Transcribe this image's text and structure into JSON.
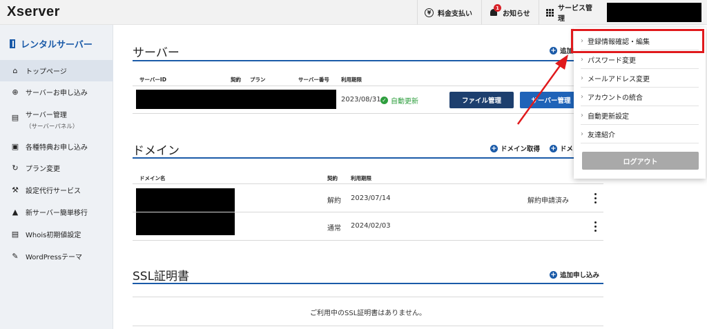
{
  "header": {
    "logo": "Xserver",
    "nav": [
      {
        "label": "料金支払い",
        "icon": "yen-icon"
      },
      {
        "label": "お知らせ",
        "icon": "bell-icon",
        "badge": "1"
      },
      {
        "label": "サービス管理",
        "icon": "grid-icon"
      }
    ]
  },
  "sidebar": {
    "title": "レンタルサーバー",
    "items": [
      {
        "label": "トップページ",
        "icon": "home-icon"
      },
      {
        "label": "サーバーお申し込み",
        "icon": "plus-circle-icon"
      },
      {
        "label": "サーバー管理",
        "sub": "（サーバーパネル）",
        "icon": "server-panel-icon"
      },
      {
        "label": "各種特典お申し込み",
        "icon": "gift-icon"
      },
      {
        "label": "プラン変更",
        "icon": "refresh-icon"
      },
      {
        "label": "設定代行サービス",
        "icon": "wrench-icon"
      },
      {
        "label": "新サーバー簡単移行",
        "icon": "migrate-icon"
      },
      {
        "label": "Whois初期値設定",
        "icon": "document-icon"
      },
      {
        "label": "WordPressテーマ",
        "icon": "edit-icon"
      }
    ]
  },
  "server_section": {
    "title": "サーバー",
    "add_label": "追加申",
    "columns": [
      "サーバーID",
      "契約",
      "プラン",
      "サーバー番号",
      "利用期限"
    ],
    "row": {
      "expiry": "2023/08/31",
      "status": "自動更新",
      "file_btn": "ファイル管理",
      "server_btn": "サーバー管理"
    }
  },
  "domain_section": {
    "title": "ドメイン",
    "acquire_label": "ドメイン取得",
    "add_label": "ドメ",
    "columns": [
      "ドメイン名",
      "契約",
      "利用期限"
    ],
    "rows": [
      {
        "contract": "解約",
        "expiry": "2023/07/14",
        "note": "解約申請済み"
      },
      {
        "contract": "通常",
        "expiry": "2024/02/03",
        "note": ""
      }
    ]
  },
  "ssl_section": {
    "title": "SSL証明書",
    "add_label": "追加申し込み",
    "empty_message": "ご利用中のSSL証明書はありません。"
  },
  "account_menu": {
    "items": [
      "登録情報確認・編集",
      "パスワード変更",
      "メールアドレス変更",
      "アカウントの統合",
      "自動更新設定",
      "友達紹介"
    ],
    "logout": "ログアウト"
  },
  "colors": {
    "accent": "#1a5aa8",
    "primary_button": "#1d3f6e",
    "secondary_button": "#1f63b8",
    "highlight": "#e0191c",
    "success": "#2e9e3e"
  }
}
